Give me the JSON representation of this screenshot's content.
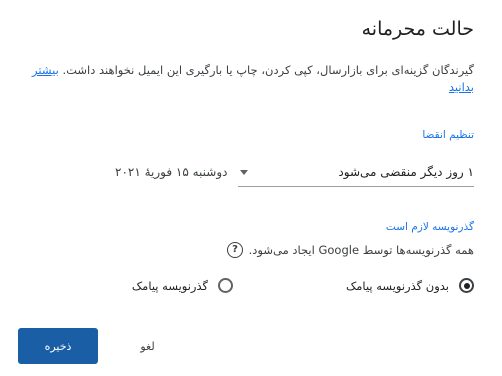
{
  "dialog": {
    "title": "حالت محرمانه",
    "description": "گیرندگان گزینه‌ای برای بازارسال، کپی کردن، چاپ یا بارگیری این ایمیل نخواهند داشت.",
    "learn_more": "بیشتر بدانید"
  },
  "expiry": {
    "label": "تنظیم انقضا",
    "selected": "۱ روز دیگر منقضی می‌شود",
    "date": "دوشنبه ۱۵ فوریهٔ ۲۰۲۱"
  },
  "passcode": {
    "label": "گذرنویسه لازم است",
    "description": "همه گذرنویسه‌ها توسط Google ایجاد می‌شود.",
    "options": [
      {
        "label": "بدون گذرنویسه پیامک",
        "checked": true
      },
      {
        "label": "گذرنویسه پیامک",
        "checked": false
      }
    ]
  },
  "buttons": {
    "save": "ذخیره",
    "cancel": "لغو"
  }
}
